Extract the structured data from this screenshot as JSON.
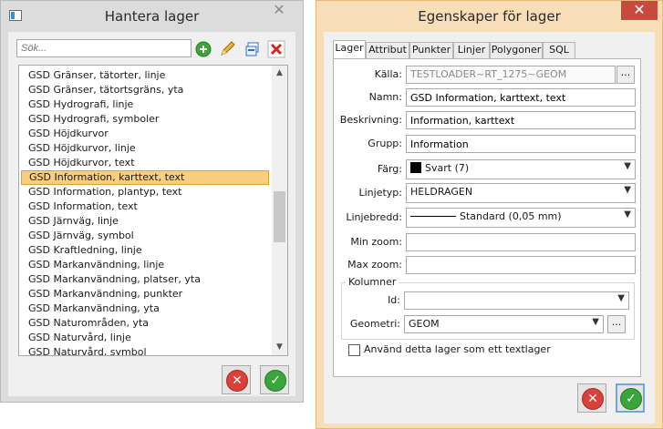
{
  "layers_window": {
    "title": "Hantera lager",
    "close_glyph": "✕",
    "search": {
      "placeholder": "Sök..."
    },
    "layers": [
      "GSD Gränser, tätorter, linje",
      "GSD Gränser, tätortsgräns, yta",
      "GSD Hydrografi, linje",
      "GSD Hydrografi, symboler",
      "GSD Höjdkurvor",
      "GSD Höjdkurvor, linje",
      "GSD Höjdkurvor, text",
      "GSD Information, karttext, text",
      "GSD Information, plantyp, text",
      "GSD Information, text",
      "GSD Järnväg, linje",
      "GSD Järnväg, symbol",
      "GSD Kraftledning, linje",
      "GSD Markanvändning, linje",
      "GSD Markanvändning, platser, yta",
      "GSD Markanvändning, punkter",
      "GSD Markanvändning, yta",
      "GSD Naturområden, yta",
      "GSD Naturvård, linje",
      "GSD Naturvård, symbol"
    ],
    "selected_layer": "GSD Information, karttext, text"
  },
  "properties_window": {
    "title": "Egenskaper för lager",
    "close_glyph": "✕",
    "tabs": [
      "Lager",
      "Attribut",
      "Punkter",
      "Linjer",
      "Polygoner",
      "SQL"
    ],
    "active_tab": "Lager",
    "fields": {
      "kalla": {
        "label": "Källa:",
        "value": "TESTLOADER~RT_1275~GEOM",
        "button": "..."
      },
      "namn": {
        "label": "Namn:",
        "value": "GSD Information, karttext, text"
      },
      "beskrivning": {
        "label": "Beskrivning:",
        "value": "Information, karttext"
      },
      "grupp": {
        "label": "Grupp:",
        "value": "Information"
      },
      "farg": {
        "label": "Färg:",
        "value": "Svart (7)",
        "swatch": "#000000"
      },
      "linjetyp": {
        "label": "Linjetyp:",
        "value": "HELDRAGEN"
      },
      "linjebredd": {
        "label": "Linjebredd:",
        "value": "Standard (0,05 mm)"
      },
      "min_zoom": {
        "label": "Min zoom:",
        "value": ""
      },
      "max_zoom": {
        "label": "Max zoom:",
        "value": ""
      }
    },
    "columns": {
      "group_label": "Kolumner",
      "id": {
        "label": "Id:",
        "value": ""
      },
      "geometri": {
        "label": "Geometri:",
        "value": "GEOM",
        "button": "..."
      }
    },
    "textlayer_checkbox": {
      "label": "Använd detta lager som ett textlager",
      "checked": false
    }
  },
  "colors": {
    "selection": "#f9cf7f",
    "active_window_frame": "#f7ddb8",
    "close_active": "#c94a3c",
    "cancel": "#d9423a",
    "ok": "#3aa53a"
  }
}
